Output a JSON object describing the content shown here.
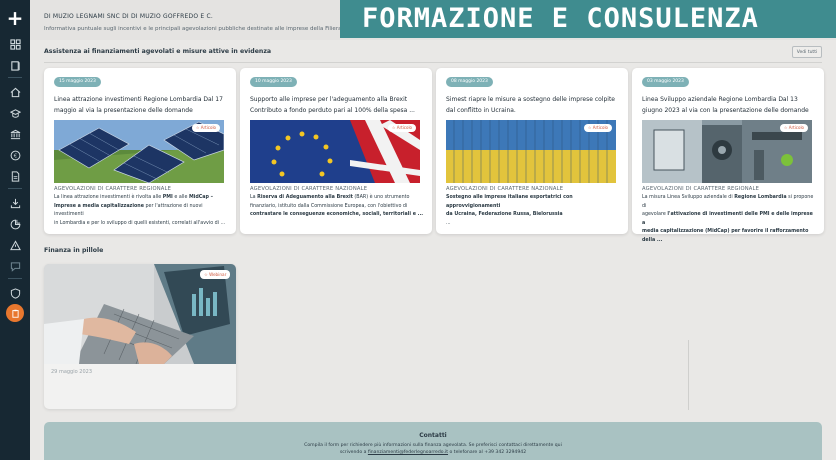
{
  "header": {
    "breadcrumb": "DI MUZIO LEGNAMI SNC DI DI MUZIO GOFFREDO E C.",
    "intro": "Informativa puntuale sugli incentivi e le principali agevolazioni pubbliche destinate alle imprese della Filiera a livello europeo, n...",
    "banner": "FORMAZIONE E CONSULENZA"
  },
  "sidebar": {
    "icons": [
      "plus-icon",
      "grid-icon",
      "book-icon",
      "home-icon",
      "graduation-icon",
      "bank-icon",
      "euro-icon",
      "document-icon",
      "download-icon",
      "chart-icon",
      "warning-icon",
      "chat-icon",
      "shield-icon",
      "shield-check-icon",
      "clipboard-icon"
    ]
  },
  "featured": {
    "title": "Assistenza ai finanziamenti agevolati e misure attive in evidenza",
    "view_all": "Vedi tutti",
    "cards": [
      {
        "date": "15 maggio 2023",
        "title": "Linea attrazione investimenti Regione Lombardia Dal 17 maggio al via la presentazione delle domande",
        "tag": "☆ Articolo",
        "category": "AGEVOLAZIONI DI CARATTERE REGIONALE",
        "desc1": "La linea attrazione investimenti è rivolta alle ",
        "desc1b": "PMI",
        "desc1c": " e alle ",
        "desc1d": "MidCap –",
        "desc2": "Imprese a media capitalizzazione",
        "desc2b": " per l'attrazione di nuovi investimenti",
        "desc3": "in Lombardia e per lo sviluppo di quelli esistenti, correlati all'avvio di ..."
      },
      {
        "date": "10 maggio 2023",
        "title": "Supporto alle imprese per l'adeguamento alla Brexit Contributo a fondo perduto pari al 100% della spesa ...",
        "tag": "☆ Articolo",
        "category": "AGEVOLAZIONI DI CARATTERE NAZIONALE",
        "desc1": "La ",
        "desc1b": "Riserva di Adeguamento alla Brexit",
        "desc1c": " (BAR) è uno strumento",
        "desc1d": "",
        "desc2": "",
        "desc2b": "finanziario, istituito dalla Commissione Europea, con l'obiettivo di",
        "desc3": "contrastare le conseguenze economiche, sociali, territoriali e ..."
      },
      {
        "date": "08 maggio 2023",
        "title": "Simest riapre le misure a sostegno delle imprese colpite dal conflitto in Ucraina.",
        "tag": "☆ Articolo",
        "category": "AGEVOLAZIONI DI CARATTERE NAZIONALE",
        "desc1": "",
        "desc1b": "Sostegno alle imprese italiane esportatrici con approvvigionamenti",
        "desc1c": "",
        "desc1d": "",
        "desc2": "da Ucraina, Federazione Russa, Bielorussia",
        "desc2b": "",
        "desc3": "..."
      },
      {
        "date": "03 maggio 2023",
        "title": "Linea Sviluppo aziendale Regione Lombardia Dal 13 giugno 2023 al via con la presentazione delle domande",
        "tag": "☆ Articolo",
        "category": "AGEVOLAZIONI DI CARATTERE REGIONALE",
        "desc1": "La misura Linea Sviluppo aziendale di ",
        "desc1b": "Regione Lombardia",
        "desc1c": " si propone di",
        "desc1d": "",
        "desc2": "agevolare ",
        "desc2b": "l'attivazione di investimenti delle PMI e delle imprese a",
        "desc3": "media capitalizzazione (MidCap) per favorire il rafforzamento della ..."
      }
    ]
  },
  "pills": {
    "title": "Finanza in pillole",
    "card": {
      "tag": "☆ Webinar",
      "date": "29 maggio 2023"
    }
  },
  "contact": {
    "title": "Contatti",
    "line1": "Compila il form per richiedere più informazioni sulla finanza agevolata. Se preferisci contattaci direttamente qui",
    "line2a": "scrivendo a ",
    "line2_email": "finanziamenti@federlegnoarredo.it",
    "line2b": " o telefonare al +39 342 3294942"
  },
  "colors": {
    "sidebar": "#172833",
    "banner": "#3f8c8f",
    "date_pill": "#7eb1b6",
    "accent_orange": "#e8772e",
    "contact_bg": "#a9c2c2"
  }
}
